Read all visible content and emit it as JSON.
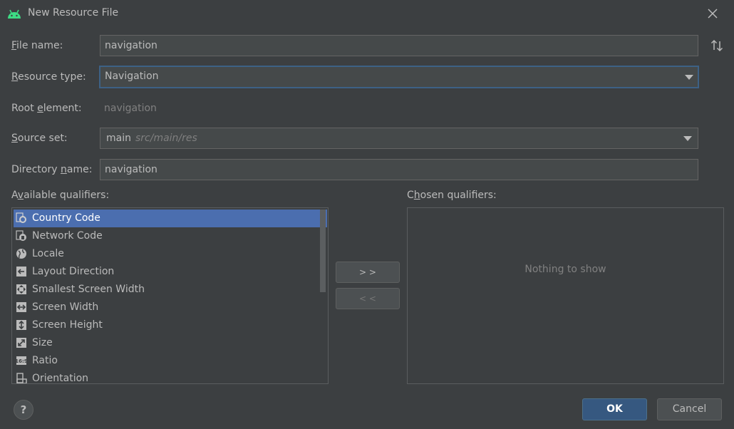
{
  "window": {
    "title": "New Resource File",
    "icon": "android-icon",
    "close_icon": "close-icon"
  },
  "form": {
    "file_name": {
      "label_mnemonic": "F",
      "label_rest": "ile name:",
      "value": "navigation"
    },
    "resource_type": {
      "label_mnemonic": "R",
      "label_rest": "esource type:",
      "value": "Navigation"
    },
    "root_element": {
      "label_pre": "Root ",
      "label_mnemonic": "e",
      "label_rest": "lement:",
      "value": "navigation"
    },
    "source_set": {
      "label_mnemonic": "S",
      "label_rest": "ource set:",
      "value": "main",
      "hint": "src/main/res"
    },
    "directory_name": {
      "label_pre": "Directory ",
      "label_mnemonic": "n",
      "label_rest": "ame:",
      "value": "navigation"
    }
  },
  "qualifiers": {
    "available_label_pre": "A",
    "available_label_mnemonic": "v",
    "available_label_rest": "ailable qualifiers:",
    "chosen_label_pre": "C",
    "chosen_label_mnemonic": "h",
    "chosen_label_rest": "osen qualifiers:",
    "available": [
      {
        "label": "Country Code",
        "icon": "country-code-icon",
        "selected": true
      },
      {
        "label": "Network Code",
        "icon": "network-code-icon",
        "selected": false
      },
      {
        "label": "Locale",
        "icon": "globe-icon",
        "selected": false
      },
      {
        "label": "Layout Direction",
        "icon": "layout-direction-icon",
        "selected": false
      },
      {
        "label": "Smallest Screen Width",
        "icon": "smallest-width-icon",
        "selected": false
      },
      {
        "label": "Screen Width",
        "icon": "screen-width-icon",
        "selected": false
      },
      {
        "label": "Screen Height",
        "icon": "screen-height-icon",
        "selected": false
      },
      {
        "label": "Size",
        "icon": "size-icon",
        "selected": false
      },
      {
        "label": "Ratio",
        "icon": "ratio-icon",
        "selected": false
      },
      {
        "label": "Orientation",
        "icon": "orientation-icon",
        "selected": false
      }
    ],
    "add_button": "> >",
    "remove_button": "< <",
    "chosen_empty": "Nothing to show"
  },
  "buttons": {
    "help": "?",
    "ok": "OK",
    "cancel": "Cancel"
  },
  "colors": {
    "background": "#3c3f41",
    "selection": "#4b6eaf",
    "focus_border": "#3d6185",
    "primary_button": "#365880",
    "android_green": "#3ddc84"
  }
}
